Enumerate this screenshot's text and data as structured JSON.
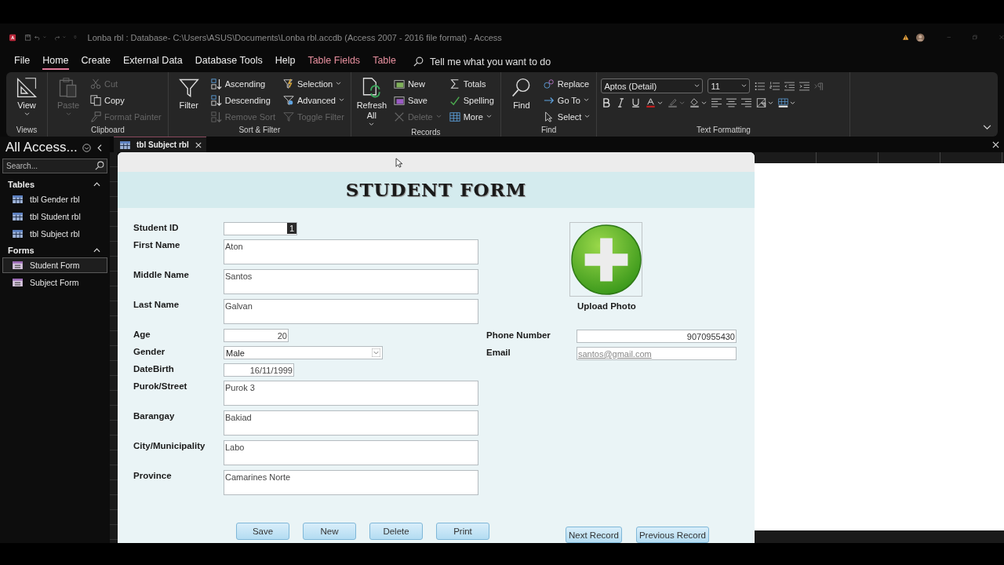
{
  "window": {
    "title": "Lonba rbl : Database- C:\\Users\\ASUS\\Documents\\Lonba rbl.accdb (Access 2007 - 2016 file format)  -  Access"
  },
  "menu_tabs": [
    {
      "label": "File",
      "selected": false,
      "contextual": false
    },
    {
      "label": "Home",
      "selected": true,
      "contextual": false
    },
    {
      "label": "Create",
      "selected": false,
      "contextual": false
    },
    {
      "label": "External Data",
      "selected": false,
      "contextual": false
    },
    {
      "label": "Database Tools",
      "selected": false,
      "contextual": false
    },
    {
      "label": "Help",
      "selected": false,
      "contextual": false
    },
    {
      "label": "Table Fields",
      "selected": false,
      "contextual": true
    },
    {
      "label": "Table",
      "selected": false,
      "contextual": true
    }
  ],
  "tell_me": {
    "placeholder": "Tell me what you want to do"
  },
  "ribbon": {
    "groups": [
      {
        "label": "Views",
        "large": [
          {
            "label": "View",
            "menu": true,
            "disabled": false
          }
        ]
      },
      {
        "label": "Clipboard",
        "large": [
          {
            "label": "Paste",
            "menu": true,
            "disabled": true
          }
        ],
        "columns": [
          [
            {
              "label": "Cut",
              "menu": false,
              "disabled": true
            },
            {
              "label": "Copy",
              "menu": false,
              "disabled": false
            },
            {
              "label": "Format Painter",
              "menu": false,
              "disabled": true
            }
          ]
        ]
      },
      {
        "label": "Sort & Filter",
        "large": [
          {
            "label": "Filter",
            "menu": false,
            "disabled": false
          }
        ],
        "columns": [
          [
            {
              "label": "Ascending",
              "menu": false,
              "disabled": false
            },
            {
              "label": "Descending",
              "menu": false,
              "disabled": false
            },
            {
              "label": "Remove Sort",
              "menu": false,
              "disabled": true
            }
          ],
          [
            {
              "label": "Selection",
              "menu": true,
              "disabled": false
            },
            {
              "label": "Advanced",
              "menu": true,
              "disabled": false
            },
            {
              "label": "Toggle Filter",
              "menu": false,
              "disabled": true
            }
          ]
        ]
      },
      {
        "label": "Records",
        "large": [
          {
            "label": "Refresh All",
            "menu": true,
            "disabled": false
          }
        ],
        "columns": [
          [
            {
              "label": "New",
              "menu": false,
              "disabled": false
            },
            {
              "label": "Save",
              "menu": false,
              "disabled": false
            },
            {
              "label": "Delete",
              "menu": true,
              "disabled": true
            }
          ],
          [
            {
              "label": "Totals",
              "menu": false,
              "disabled": false
            },
            {
              "label": "Spelling",
              "menu": false,
              "disabled": false
            },
            {
              "label": "More",
              "menu": true,
              "disabled": false
            }
          ]
        ]
      },
      {
        "label": "Find",
        "large": [
          {
            "label": "Find",
            "menu": false,
            "disabled": false
          }
        ],
        "columns": [
          [
            {
              "label": "Replace",
              "menu": false,
              "disabled": false
            },
            {
              "label": "Go To",
              "menu": true,
              "disabled": false
            },
            {
              "label": "Select",
              "menu": true,
              "disabled": false
            }
          ]
        ]
      }
    ],
    "text_formatting": {
      "label": "Text Formatting",
      "font": "Aptos (Detail)",
      "size": "11"
    }
  },
  "nav_pane": {
    "title": "All Access...",
    "search": {
      "placeholder": "Search..."
    },
    "sections": [
      {
        "label": "Tables",
        "expanded": true,
        "items": [
          {
            "label": "tbl Gender rbl",
            "kind": "table",
            "selected": false
          },
          {
            "label": "tbl Student rbl",
            "kind": "table",
            "selected": false
          },
          {
            "label": "tbl Subject rbl",
            "kind": "table",
            "selected": false
          }
        ]
      },
      {
        "label": "Forms",
        "expanded": true,
        "items": [
          {
            "label": "Student Form",
            "kind": "form",
            "selected": true
          },
          {
            "label": "Subject Form",
            "kind": "form",
            "selected": false
          }
        ]
      }
    ]
  },
  "document_tabs": [
    {
      "label": "tbl Subject rbl",
      "selected": true
    }
  ],
  "form": {
    "title": "STUDENT FORM",
    "fields": [
      {
        "label": "Student ID",
        "value": "1",
        "kind": "id",
        "highlighted": true
      },
      {
        "label": "First Name",
        "value": "Aton",
        "kind": "text",
        "highlighted": false
      },
      {
        "label": "Middle Name",
        "value": "Santos",
        "kind": "text",
        "highlighted": false
      },
      {
        "label": "Last Name",
        "value": "Galvan",
        "kind": "text",
        "highlighted": false
      },
      {
        "label": "Age",
        "value": "20",
        "kind": "number",
        "highlighted": false
      },
      {
        "label": "Gender",
        "value": "Male",
        "kind": "combo",
        "highlighted": false
      },
      {
        "label": "DateBirth",
        "value": "16/11/1999",
        "kind": "date",
        "highlighted": false
      },
      {
        "label": "Purok/Street",
        "value": "Purok 3",
        "kind": "text",
        "highlighted": false
      },
      {
        "label": "Barangay",
        "value": "Bakiad",
        "kind": "text",
        "highlighted": false
      },
      {
        "label": "City/Municipality",
        "value": "Labo",
        "kind": "text",
        "highlighted": false
      },
      {
        "label": "Province",
        "value": "Camarines Norte",
        "kind": "text",
        "highlighted": false
      }
    ],
    "photo": {
      "caption": "Upload Photo"
    },
    "contact_fields": [
      {
        "label": "Phone Number",
        "value": "9070955430",
        "kind": "number"
      },
      {
        "label": "Email",
        "value": "santos@gmail.com",
        "kind": "email"
      }
    ],
    "actions": [
      "Save",
      "New",
      "Delete",
      "Print"
    ],
    "navigation": [
      "Next Record",
      "Previous Record"
    ]
  }
}
